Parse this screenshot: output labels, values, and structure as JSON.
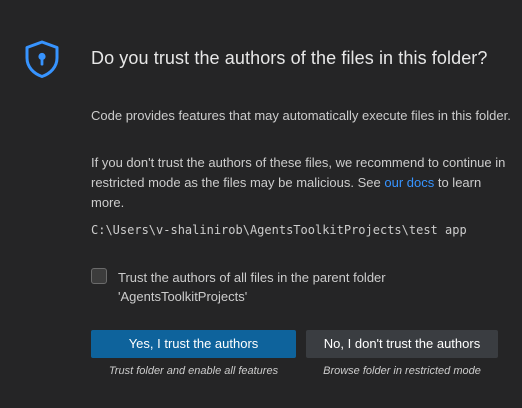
{
  "dialog": {
    "title": "Do you trust the authors of the files in this folder?",
    "paragraph1": "Code provides features that may automatically execute files in this folder.",
    "paragraph2_before_link": "If you don't trust the authors of these files, we recommend to continue in restricted mode as the files may be malicious. See ",
    "paragraph2_link": "our docs",
    "paragraph2_after_link": " to learn more.",
    "folder_path": "C:\\Users\\v-shalinirob\\AgentsToolkitProjects\\test app",
    "checkbox": {
      "label_line1": "Trust the authors of all files in the parent folder",
      "label_line2": "'AgentsToolkitProjects'",
      "checked": false
    },
    "buttons": {
      "trust_label": "Yes, I trust the authors",
      "trust_caption": "Trust folder and enable all features",
      "distrust_label": "No, I don't trust the authors",
      "distrust_caption": "Browse folder in restricted mode"
    }
  },
  "icons": {
    "header": "shield-lock-icon"
  },
  "colors": {
    "background": "#252526",
    "primary_button": "#0e639c",
    "secondary_button": "#3a3d41",
    "link": "#3794ff",
    "icon": "#3794ff"
  }
}
